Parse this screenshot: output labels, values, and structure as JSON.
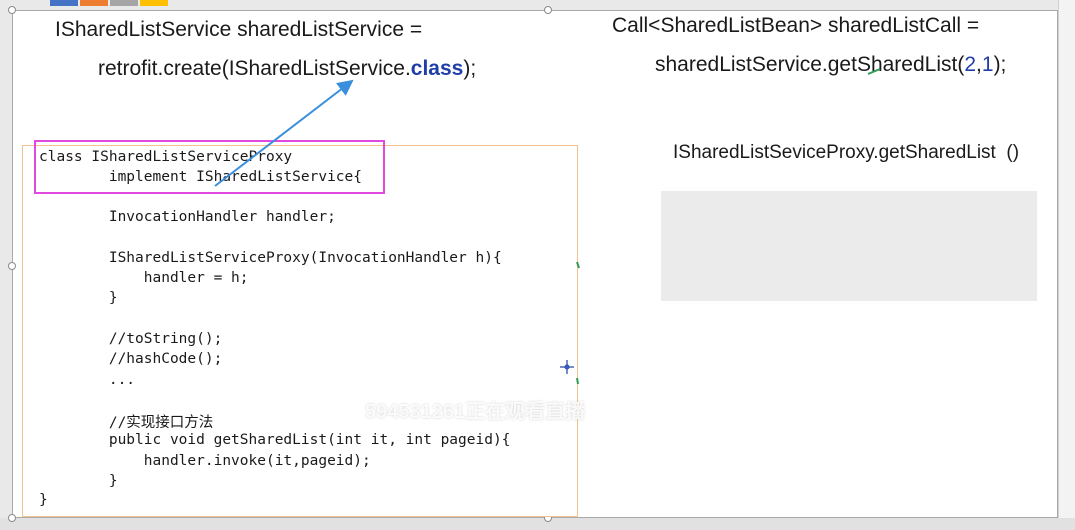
{
  "colors": {
    "accent_strip": [
      "#4472c4",
      "#ed7d31",
      "#a5a5a5",
      "#ffc000"
    ],
    "highlight_box": "#e04adf",
    "arrow": "#3a8fdc",
    "code_border": "#f2c38e",
    "keyword": "#1f3ea8"
  },
  "left_header": {
    "line1": "ISharedListService sharedListService =",
    "line2_prefix": "retrofit.create(ISharedListService.",
    "line2_keyword": "class",
    "line2_suffix": ");"
  },
  "right_header": {
    "line1": "Call<SharedListBean> sharedListCall =",
    "line2_prefix": "sharedListService.getSharedList(",
    "line2_arg1": "2",
    "line2_comma": ",",
    "line2_arg2": "1",
    "line2_suffix": ");"
  },
  "proxy_call": "ISharedListSeviceProxy.getSharedList  ()",
  "code_lines": [
    "class ISharedListServiceProxy",
    "        implement ISharedListService{",
    "        InvocationHandler handler;",
    "        ISharedListServiceProxy(InvocationHandler h){",
    "            handler = h;",
    "        }",
    "        //toString();",
    "        //hashCode();",
    "        ...",
    "        //实现接口方法",
    "        public void getSharedList(int it, int pageid){",
    "            handler.invoke(it,pageid);",
    "        }",
    "}"
  ],
  "watermark": "594531261正在观看直播",
  "icons": {
    "crosshair": "crosshair-icon",
    "arrow": "arrow-annotation"
  }
}
